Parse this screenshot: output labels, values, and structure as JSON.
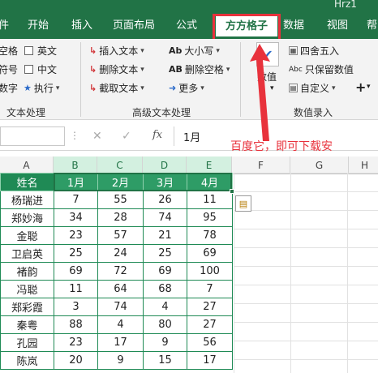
{
  "window": {
    "title_fragment": "Hrz1"
  },
  "tabs": [
    {
      "label": "件"
    },
    {
      "label": "开始"
    },
    {
      "label": "插入"
    },
    {
      "label": "页面布局"
    },
    {
      "label": "公式"
    },
    {
      "label": "方方格子"
    },
    {
      "label": "数据"
    },
    {
      "label": "视图"
    },
    {
      "label": "帮"
    }
  ],
  "ribbon": {
    "groups": [
      {
        "label": "文本处理"
      },
      {
        "label": "高级文本处理"
      },
      {
        "label": "数值录入"
      }
    ],
    "left_items": [
      "空格",
      "符号",
      "数字"
    ],
    "checkboxes": [
      "英文",
      "中文"
    ],
    "execute": "执行",
    "advanced": [
      "插入文本",
      "删除文本",
      "截取文本"
    ],
    "case_items": [
      "大小写",
      "删除空格",
      "更多"
    ],
    "numeric_button": "数值",
    "round": "四舍五入",
    "keep_value": "只保留数值",
    "custom": "自定义",
    "plus": "+"
  },
  "formula_bar": {
    "name_box": "",
    "cancel": "✕",
    "enter": "✓",
    "fx": "fx",
    "value": "1月"
  },
  "annotation": "百度它，即可下载安",
  "columns": [
    "A",
    "B",
    "C",
    "D",
    "E",
    "F",
    "G",
    "H"
  ],
  "table": {
    "headers": [
      "姓名",
      "1月",
      "2月",
      "3月",
      "4月"
    ],
    "rows": [
      [
        "杨瑞进",
        "7",
        "55",
        "26",
        "11"
      ],
      [
        "郑妙海",
        "34",
        "28",
        "74",
        "95"
      ],
      [
        "金聪",
        "23",
        "57",
        "21",
        "78"
      ],
      [
        "卫启英",
        "25",
        "24",
        "25",
        "69"
      ],
      [
        "褚韵",
        "69",
        "72",
        "69",
        "100"
      ],
      [
        "冯聪",
        "11",
        "64",
        "68",
        "7"
      ],
      [
        "郑彩霞",
        "3",
        "74",
        "4",
        "27"
      ],
      [
        "秦粤",
        "88",
        "4",
        "80",
        "27"
      ],
      [
        "孔园",
        "23",
        "17",
        "9",
        "56"
      ],
      [
        "陈岚",
        "20",
        "9",
        "15",
        "17"
      ]
    ]
  },
  "colors": {
    "excel_green": "#217346",
    "header_fill": "#1f8a55",
    "annotation_red": "#e8323c"
  }
}
